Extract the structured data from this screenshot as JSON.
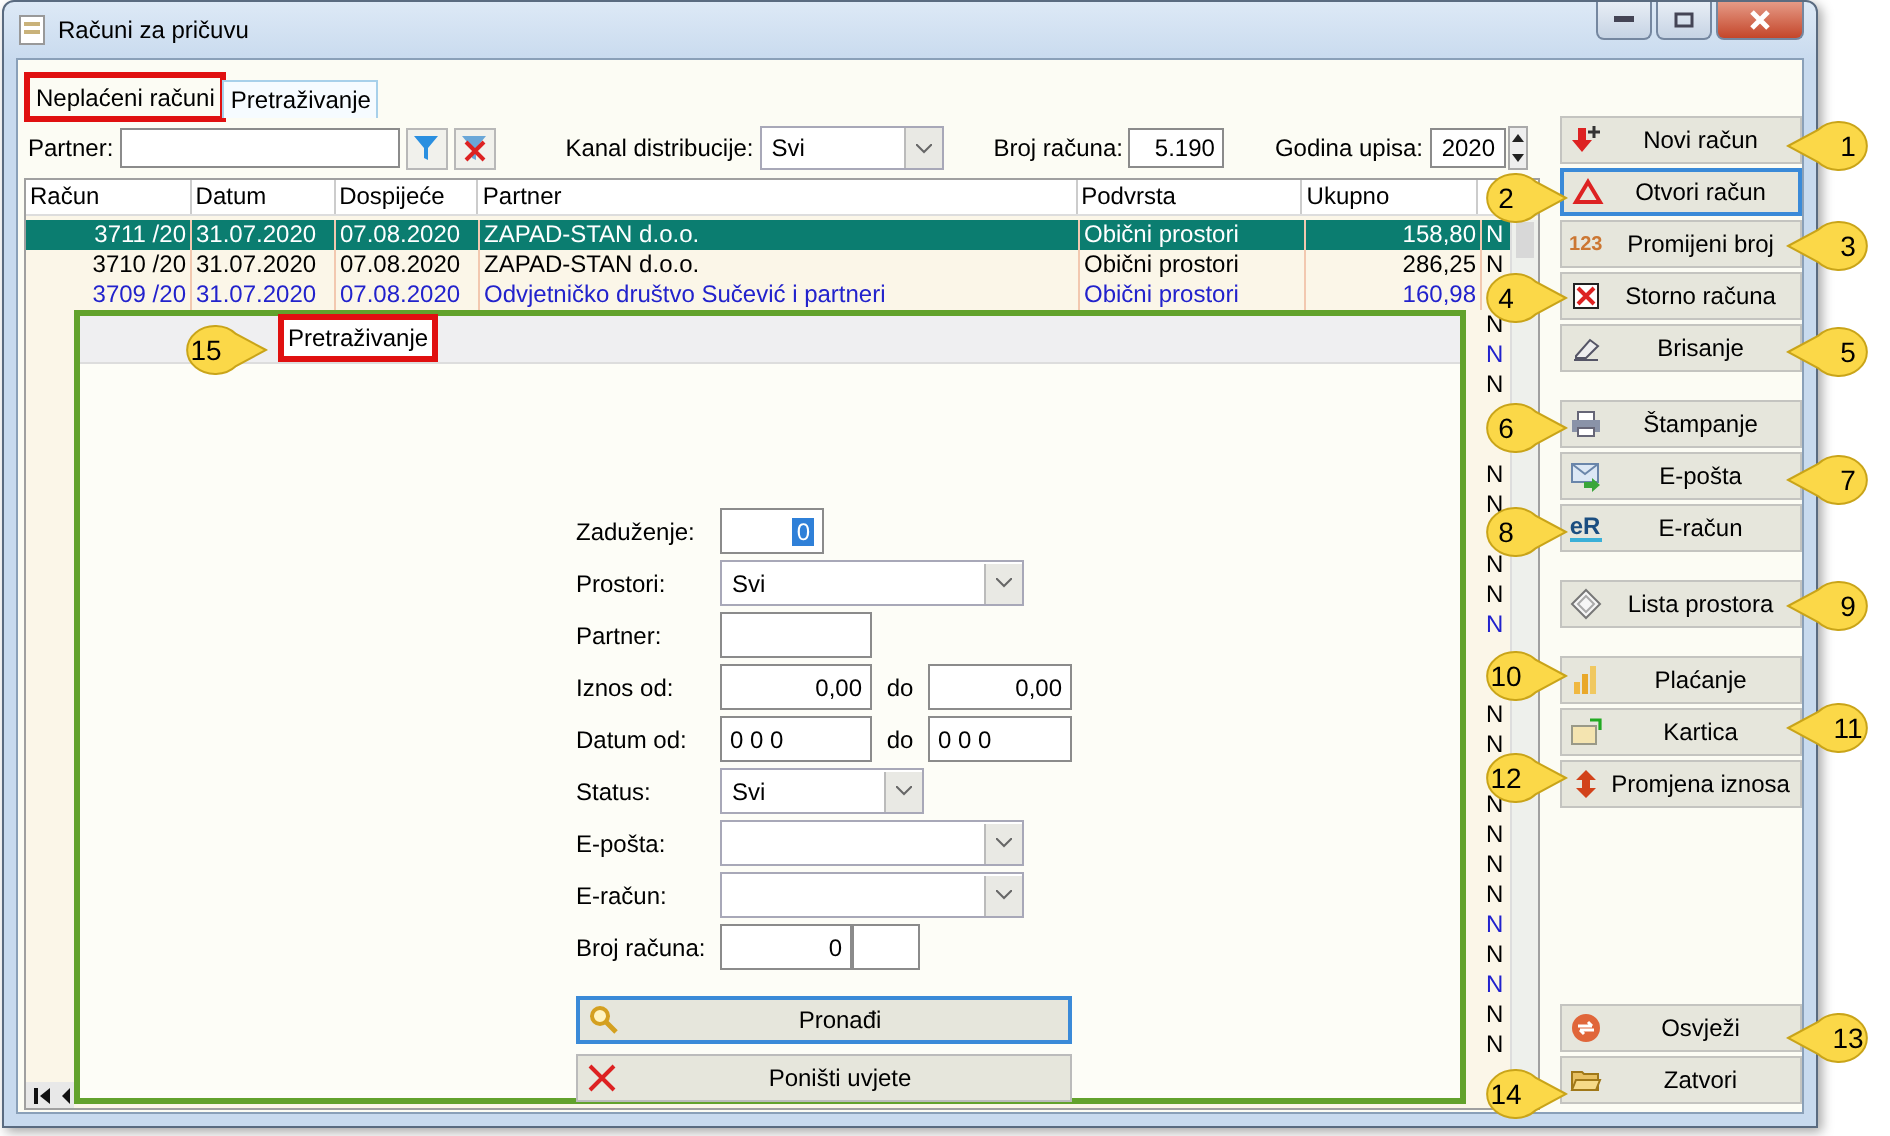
{
  "window": {
    "title": "Računi za pričuvu"
  },
  "tabs": [
    {
      "label": "Neplaćeni računi",
      "selected": true,
      "annotated": true
    },
    {
      "label": "Pretraživanje",
      "selected": false,
      "annotated": false
    }
  ],
  "filters": {
    "partner_label": "Partner:",
    "channel_label": "Kanal distribucije:",
    "channel_value": "Svi",
    "number_label": "Broj računa:",
    "number_value": "5.190",
    "year_label": "Godina upisa:",
    "year_value": "2020"
  },
  "table": {
    "columns": [
      "Račun",
      "Datum",
      "Dospijeće",
      "Partner",
      "Podvrsta",
      "Ukupno"
    ],
    "rows": [
      {
        "cells": [
          "3711 /20",
          "31.07.2020",
          "07.08.2020",
          "ZAPAD-STAN d.o.o.",
          "Obični prostori",
          "158,80"
        ],
        "n": "N",
        "selected": true
      },
      {
        "cells": [
          "3710 /20",
          "31.07.2020",
          "07.08.2020",
          "ZAPAD-STAN d.o.o.",
          "Obični prostori",
          "286,25"
        ],
        "n": "N",
        "selected": false,
        "color": "#000000"
      },
      {
        "cells": [
          "3709 /20",
          "31.07.2020",
          "07.08.2020",
          "Odvjetničko društvo Sučević i partneri",
          "Obični prostori",
          "160,98"
        ],
        "selected": false,
        "color": "#2222cc"
      },
      {
        "n": "N",
        "selected": false,
        "color": "#000000"
      },
      {
        "n": "N",
        "selected": false,
        "color": "#2222cc"
      },
      {
        "n": "N",
        "selected": false,
        "color": "#000000"
      },
      {
        "selected": false
      },
      {
        "selected": false
      },
      {
        "n": "N",
        "selected": false,
        "color": "#000000"
      },
      {
        "n": "N",
        "selected": false,
        "color": "#000000"
      },
      {
        "selected": false
      },
      {
        "n": "N",
        "selected": false,
        "color": "#000000"
      },
      {
        "n": "N",
        "selected": false,
        "color": "#000000"
      },
      {
        "n": "N",
        "selected": false,
        "color": "#2222cc"
      },
      {
        "selected": false
      },
      {
        "selected": false
      },
      {
        "n": "N",
        "selected": false,
        "color": "#000000"
      },
      {
        "n": "N",
        "selected": false,
        "color": "#000000"
      },
      {
        "selected": false
      },
      {
        "n": "N",
        "selected": false,
        "color": "#000000"
      },
      {
        "n": "N",
        "selected": false,
        "color": "#000000"
      },
      {
        "n": "N",
        "selected": false,
        "color": "#000000"
      },
      {
        "n": "N",
        "selected": false,
        "color": "#000000"
      },
      {
        "n": "N",
        "selected": false,
        "color": "#2222cc"
      },
      {
        "n": "N",
        "selected": false,
        "color": "#000000"
      },
      {
        "n": "N",
        "selected": false,
        "color": "#2222cc"
      },
      {
        "n": "N",
        "selected": false,
        "color": "#000000"
      },
      {
        "n": "N",
        "selected": false,
        "color": "#000000"
      }
    ]
  },
  "search_panel": {
    "tab": "Pretraživanje",
    "annotated": true,
    "fields": [
      {
        "label": "Zaduženje:",
        "kind": "input",
        "value": "0",
        "text_selected": true
      },
      {
        "label": "Prostori:",
        "kind": "select",
        "value": "Svi"
      },
      {
        "label": "Partner:",
        "kind": "input"
      },
      {
        "label": "Iznos od:",
        "kind": "amount-range",
        "from": "0,00",
        "to_label": "do",
        "to": "0,00"
      },
      {
        "label": "Datum od:",
        "kind": "date-range",
        "from": "0 0 0",
        "to_label": "do",
        "to": "0 0 0"
      },
      {
        "label": "Status:",
        "kind": "select",
        "value": "Svi"
      },
      {
        "label": "E-pošta:",
        "kind": "select"
      },
      {
        "label": "E-račun:",
        "kind": "select"
      },
      {
        "label": "Broj računa:",
        "kind": "pair",
        "value": "0"
      }
    ],
    "buttons": [
      {
        "label": "Pronađi",
        "focused": true
      },
      {
        "label": "Poništi uvjete",
        "focused": false
      }
    ]
  },
  "actions": [
    [
      {
        "label": "Novi račun",
        "focused": false
      },
      {
        "label": "Otvori račun",
        "focused": true
      },
      {
        "label": "Promijeni broj",
        "icon_text": "123",
        "focused": false
      },
      {
        "label": "Storno računa",
        "focused": false
      },
      {
        "label": "Brisanje",
        "focused": false
      }
    ],
    [
      {
        "label": "Štampanje",
        "focused": false
      },
      {
        "label": "E-pošta",
        "focused": false
      },
      {
        "label": "E-račun",
        "icon_text": "eR",
        "focused": false
      }
    ],
    [
      {
        "label": "Lista prostora",
        "focused": false
      }
    ],
    [
      {
        "label": "Plaćanje",
        "focused": false
      },
      {
        "label": "Kartica",
        "focused": false
      },
      {
        "label": "Promjena iznosa",
        "focused": false
      }
    ],
    [
      {
        "label": "Osvježi",
        "focused": false
      },
      {
        "label": "Zatvori",
        "focused": false
      }
    ]
  ],
  "callouts": [
    {
      "number": "1"
    },
    {
      "number": "2"
    },
    {
      "number": "3"
    },
    {
      "number": "4"
    },
    {
      "number": "5"
    },
    {
      "number": "6"
    },
    {
      "number": "7"
    },
    {
      "number": "8"
    },
    {
      "number": "9"
    },
    {
      "number": "10"
    },
    {
      "number": "11"
    },
    {
      "number": "12"
    },
    {
      "number": "13"
    },
    {
      "number": "14"
    },
    {
      "number": "15"
    }
  ]
}
